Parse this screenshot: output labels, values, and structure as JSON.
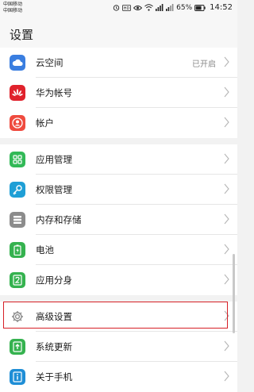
{
  "status": {
    "carrier1": "中国移动",
    "carrier2": "中国移动",
    "battery": "65%",
    "time": "14:52"
  },
  "header": {
    "title": "设置"
  },
  "groups": [
    {
      "items": [
        {
          "label": "云空间",
          "value": "已开启",
          "icon": "cloud-icon",
          "color": "#3a7ee0"
        },
        {
          "label": "华为帐号",
          "icon": "huawei-logo-icon",
          "color": "#e0222c"
        },
        {
          "label": "帐户",
          "icon": "account-icon",
          "color": "#ef4b3f"
        }
      ]
    },
    {
      "items": [
        {
          "label": "应用管理",
          "icon": "app-grid-icon",
          "color": "#32b957"
        },
        {
          "label": "权限管理",
          "icon": "key-icon",
          "color": "#1f9fd6"
        },
        {
          "label": "内存和存储",
          "icon": "storage-icon",
          "color": "#8c8c8c"
        },
        {
          "label": "电池",
          "icon": "battery-icon",
          "color": "#35b24f"
        },
        {
          "label": "应用分身",
          "icon": "app-twin-icon",
          "color": "#35b24f"
        }
      ]
    },
    {
      "items": [
        {
          "label": "高级设置",
          "icon": "gear-icon",
          "color": "#8c8c8c"
        },
        {
          "label": "系统更新",
          "icon": "system-update-icon",
          "color": "#35b24f"
        },
        {
          "label": "关于手机",
          "icon": "info-icon",
          "color": "#1f8ed6"
        }
      ]
    }
  ]
}
